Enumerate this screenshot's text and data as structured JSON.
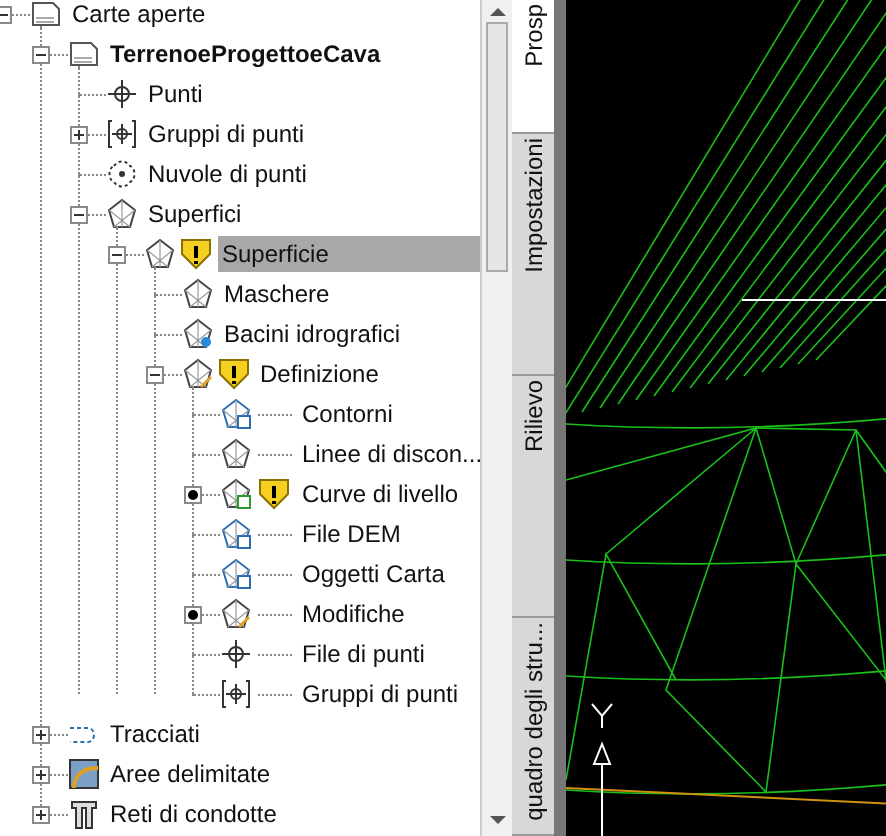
{
  "tree": [
    {
      "label": "Carte aperte",
      "kind": "drawing",
      "expanded": true,
      "selected": false,
      "warning": false,
      "bold": false,
      "children": [
        {
          "label": "TerrenoeProgettoeCava",
          "kind": "drawing",
          "expanded": true,
          "selected": false,
          "warning": false,
          "bold": true,
          "children": [
            {
              "label": "Punti",
              "kind": "points",
              "selected": false,
              "warning": false,
              "bold": false
            },
            {
              "label": "Gruppi di punti",
              "kind": "point-group",
              "expanded": false,
              "selected": false,
              "warning": false,
              "bold": false
            },
            {
              "label": "Nuvole di punti",
              "kind": "point-cloud",
              "selected": false,
              "warning": false,
              "bold": false
            },
            {
              "label": "Superfici",
              "kind": "surface",
              "expanded": true,
              "selected": false,
              "warning": false,
              "bold": false,
              "children": [
                {
                  "label": "Superficie",
                  "kind": "surface",
                  "expanded": true,
                  "selected": true,
                  "warning": true,
                  "bold": false,
                  "children": [
                    {
                      "label": "Maschere",
                      "kind": "surface",
                      "selected": false,
                      "warning": false,
                      "bold": false
                    },
                    {
                      "label": "Bacini idrografici",
                      "kind": "surface-drop",
                      "selected": false,
                      "warning": false,
                      "bold": false
                    },
                    {
                      "label": "Definizione",
                      "kind": "surface-edit",
                      "expanded": true,
                      "selected": false,
                      "warning": true,
                      "bold": false,
                      "children": [
                        {
                          "label": "Contorni",
                          "kind": "surface-blue",
                          "bullet": false,
                          "selected": false,
                          "warning": false,
                          "bold": false
                        },
                        {
                          "label": "Linee di discon...",
                          "kind": "surface",
                          "bullet": false,
                          "selected": false,
                          "warning": false,
                          "bold": false
                        },
                        {
                          "label": "Curve di livello",
                          "kind": "surface-green",
                          "bullet": true,
                          "selected": false,
                          "warning": true,
                          "bold": false
                        },
                        {
                          "label": "File DEM",
                          "kind": "surface-blue",
                          "bullet": false,
                          "selected": false,
                          "warning": false,
                          "bold": false
                        },
                        {
                          "label": "Oggetti Carta",
                          "kind": "surface-blue",
                          "bullet": false,
                          "selected": false,
                          "warning": false,
                          "bold": false
                        },
                        {
                          "label": "Modifiche",
                          "kind": "surface-edit",
                          "bullet": true,
                          "selected": false,
                          "warning": false,
                          "bold": false
                        },
                        {
                          "label": "File di punti",
                          "kind": "points",
                          "bullet": false,
                          "selected": false,
                          "warning": false,
                          "bold": false
                        },
                        {
                          "label": "Gruppi di punti",
                          "kind": "point-group",
                          "bullet": false,
                          "selected": false,
                          "warning": false,
                          "bold": false
                        }
                      ]
                    }
                  ]
                }
              ]
            }
          ]
        },
        {
          "label": "Tracciati",
          "kind": "alignment",
          "expanded": false,
          "selected": false,
          "warning": false,
          "bold": false
        },
        {
          "label": "Aree delimitate",
          "kind": "parcel",
          "expanded": false,
          "selected": false,
          "warning": false,
          "bold": false
        },
        {
          "label": "Reti di condotte",
          "kind": "pipe",
          "expanded": false,
          "selected": false,
          "warning": false,
          "bold": false
        }
      ]
    }
  ],
  "tabs": [
    {
      "label": "Prosp",
      "selected": true
    },
    {
      "label": "Impostazioni",
      "selected": false
    },
    {
      "label": "Rilievo",
      "selected": false
    },
    {
      "label": "quadro degli stru...",
      "selected": false
    }
  ]
}
